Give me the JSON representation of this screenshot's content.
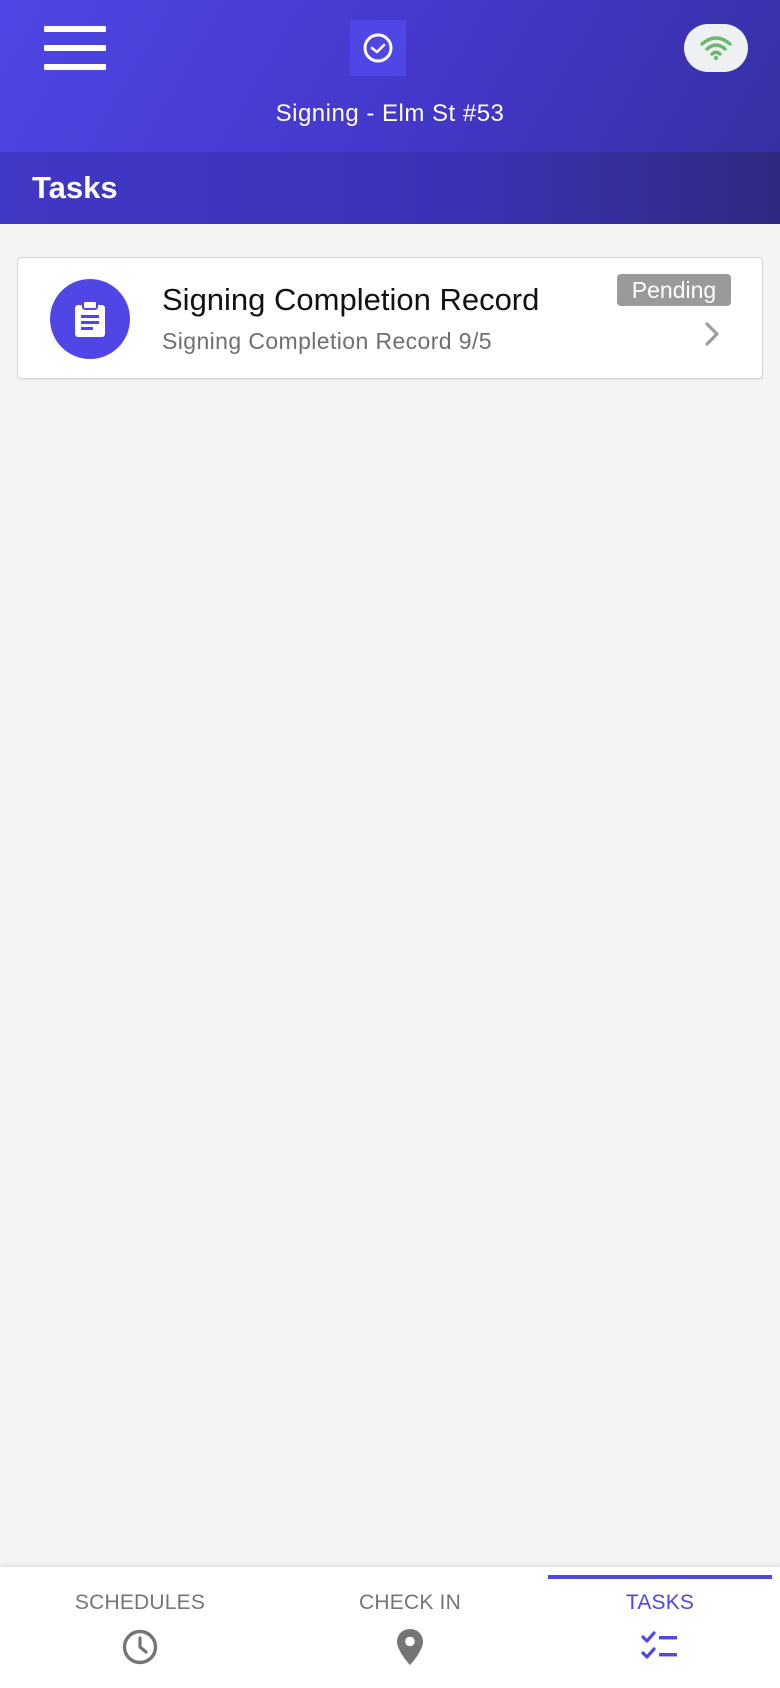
{
  "header": {
    "title": "Signing - Elm St #53",
    "menu_icon": "hamburger-menu-icon",
    "logo_icon": "clock-logo-icon",
    "connection_icon": "wifi-icon",
    "colors": {
      "primary": "#4f46e5",
      "dark": "#2f2a80",
      "wifi_green": "#66bb6a"
    }
  },
  "section": {
    "title": "Tasks"
  },
  "tasks": [
    {
      "title": "Signing Completion Record",
      "subtitle": "Signing Completion Record 9/5",
      "status": "Pending",
      "icon": "clipboard-icon"
    }
  ],
  "bottom_nav": {
    "items": [
      {
        "label": "SCHEDULES",
        "icon": "clock-icon",
        "active": false
      },
      {
        "label": "CHECK IN",
        "icon": "location-pin-icon",
        "active": false
      },
      {
        "label": "TASKS",
        "icon": "checklist-icon",
        "active": true
      }
    ]
  }
}
